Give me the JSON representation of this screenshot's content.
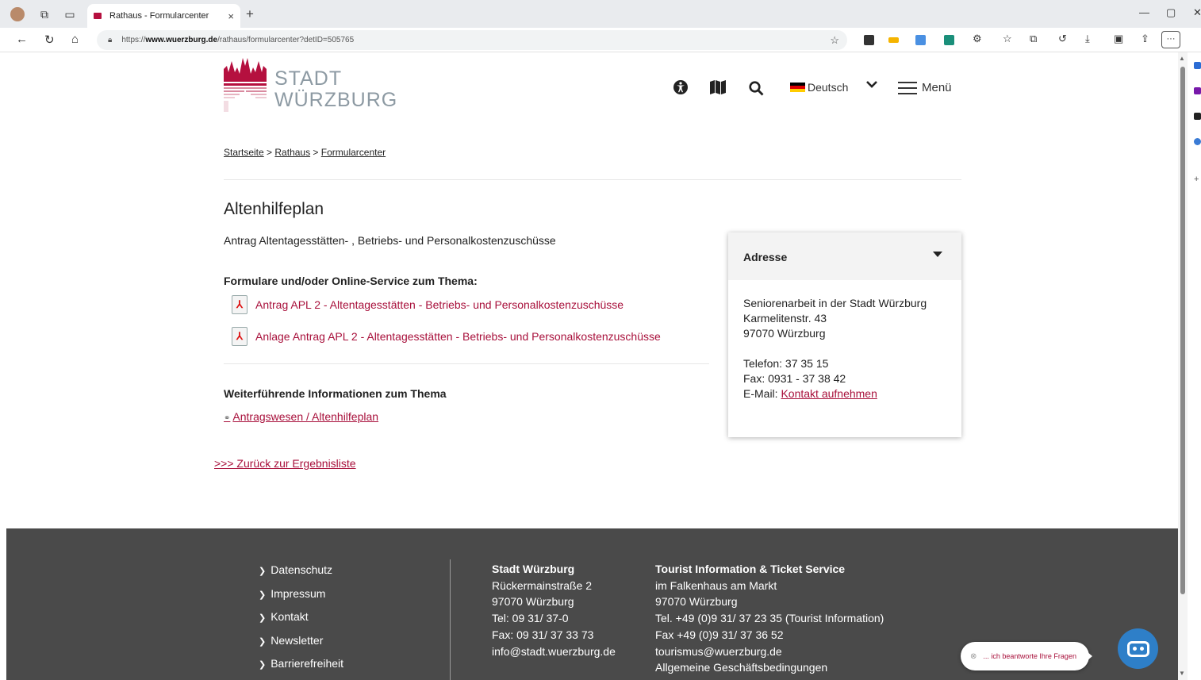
{
  "browser": {
    "tab_title": "Rathaus - Formularcenter",
    "tab_close": "×",
    "new_tab": "+",
    "url_prefix": "https://",
    "url_domain": "www.wuerzburg.de",
    "url_path": "/rathaus/formularcenter?detID=505765",
    "more_label": "···"
  },
  "header": {
    "logo_line1": "STADT",
    "logo_line2": "WÜRZBURG",
    "language": "Deutsch",
    "menu_label": "Menü"
  },
  "breadcrumb": {
    "items": [
      "Startseite",
      "Rathaus",
      "Formularcenter"
    ],
    "sep": " > "
  },
  "content": {
    "title": "Altenhilfeplan",
    "subtitle": "Antrag Altentagesstätten- , Betriebs- und Personalkostenzuschüsse",
    "forms_heading": "Formulare und/oder Online-Service zum Thema:",
    "downloads": [
      "Antrag APL 2 - Altentagesstätten - Betriebs- und Personalkostenzuschüsse",
      "Anlage Antrag APL 2 - Altentagesstätten - Betriebs- und Personalkostenzuschüsse"
    ],
    "info_heading": "Weiterführende Informationen zum Thema",
    "info_link": "Antragswesen / Altenhilfeplan",
    "back_link": ">>> Zurück zur Ergebnisliste"
  },
  "address_card": {
    "title": "Adresse",
    "org": "Seniorenarbeit in der Stadt Würzburg",
    "street": "Karmelitenstr. 43",
    "city": "97070 Würzburg",
    "phone": "Telefon: 37 35 15",
    "fax": "Fax: 0931 - 37 38 42",
    "email_label": "E-Mail: ",
    "email_link": "Kontakt aufnehmen"
  },
  "footer": {
    "nav": [
      "Datenschutz",
      "Impressum",
      "Kontakt",
      "Newsletter",
      "Barrierefreiheit"
    ],
    "city": {
      "title": "Stadt Würzburg",
      "lines": [
        "Rückermainstraße 2",
        "97070 Würzburg",
        "Tel: 09 31/ 37-0",
        "Fax: 09 31/ 37 33 73",
        "info@stadt.wuerzburg.de"
      ]
    },
    "tourist": {
      "title": "Tourist Information & Ticket Service",
      "lines": [
        "im Falkenhaus am Markt",
        "97070 Würzburg",
        "Tel. +49 (0)9 31/ 37 23 35 (Tourist Information)",
        "Fax +49 (0)9 31/ 37 36 52",
        "tourismus@wuerzburg.de",
        "Allgemeine Geschäftsbedingungen"
      ]
    }
  },
  "chat": {
    "prompt": "... ich beantworte Ihre Fragen",
    "close": "⊗"
  },
  "colors": {
    "brand_red": "#a8103b",
    "footer_bg": "#4a4a4a",
    "logo_grey": "#8d9aa3",
    "bot_blue": "#2e7fc8"
  }
}
